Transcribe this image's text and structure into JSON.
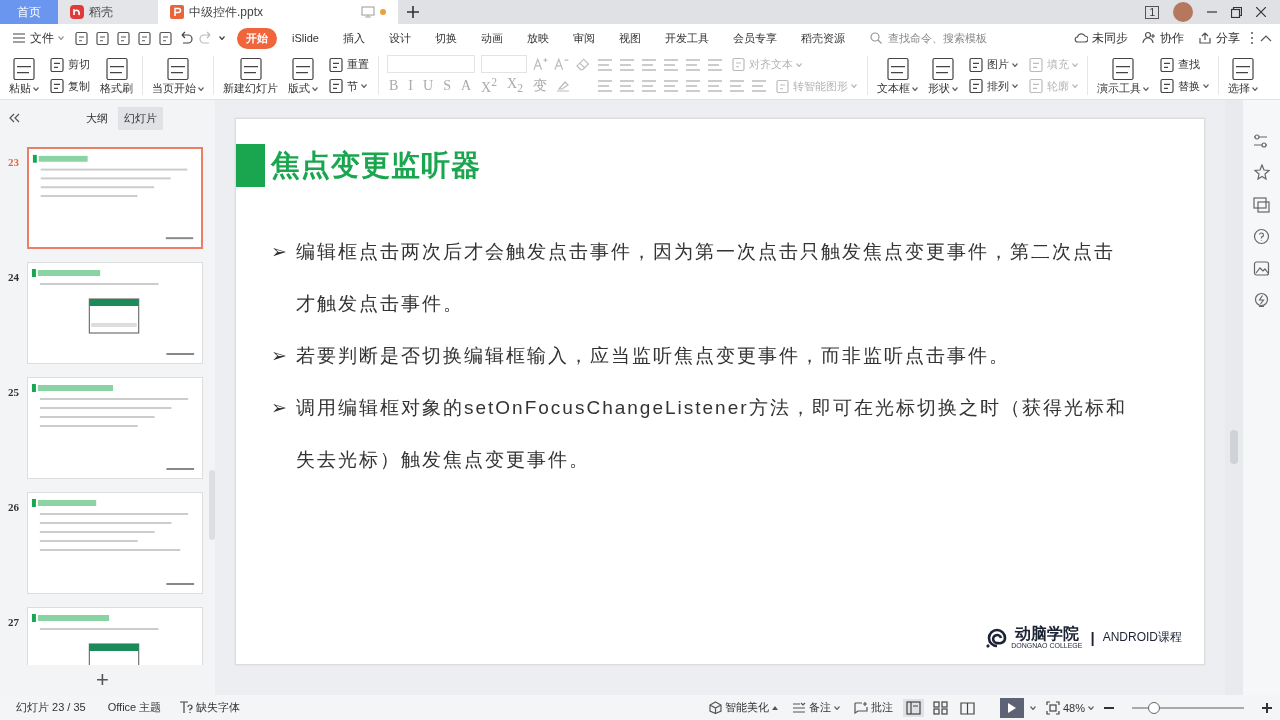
{
  "tabs": [
    {
      "label": "首页",
      "kind": "home",
      "selected": false
    },
    {
      "label": "稻壳",
      "kind": "docer",
      "selected": false
    },
    {
      "label": "中级控件.pptx",
      "kind": "doc",
      "selected": true,
      "unsaved": true
    }
  ],
  "account": {
    "badge": "1"
  },
  "menu": {
    "file": "文件",
    "tabs": [
      {
        "label": "开始",
        "selected": true
      },
      {
        "label": "iSlide",
        "selected": false
      },
      {
        "label": "插入",
        "selected": false
      },
      {
        "label": "设计",
        "selected": false
      },
      {
        "label": "切换",
        "selected": false
      },
      {
        "label": "动画",
        "selected": false
      },
      {
        "label": "放映",
        "selected": false
      },
      {
        "label": "审阅",
        "selected": false
      },
      {
        "label": "视图",
        "selected": false
      },
      {
        "label": "开发工具",
        "selected": false
      },
      {
        "label": "会员专享",
        "selected": false
      },
      {
        "label": "稻壳资源",
        "selected": false
      }
    ],
    "search": {
      "placeholder": "查找命令、搜索模板"
    },
    "actions": [
      "未同步",
      "协作",
      "分享"
    ]
  },
  "ribbon": [
    {
      "kind": "big",
      "label": "粘贴",
      "caret": true
    },
    {
      "kind": "stack",
      "items": [
        {
          "label": "剪切",
          "caret": false,
          "disabled": false
        },
        {
          "label": "复制",
          "caret": false,
          "disabled": false
        }
      ]
    },
    {
      "kind": "big",
      "label": "格式刷",
      "caret": false
    },
    {
      "kind": "sep"
    },
    {
      "kind": "big",
      "label": "当页开始",
      "caret": true
    },
    {
      "kind": "sep"
    },
    {
      "kind": "big",
      "label": "新建幻灯片",
      "caret": false
    },
    {
      "kind": "big",
      "label": "版式",
      "caret": true
    },
    {
      "kind": "stack",
      "items": [
        {
          "label": "重置",
          "caret": false,
          "disabled": false
        },
        {
          "label": "节",
          "caret": true,
          "disabled": false
        }
      ]
    },
    {
      "kind": "sep"
    },
    {
      "kind": "font",
      "marks": [
        "B",
        "I",
        "U",
        "S",
        "A",
        "X$^{2}$",
        "X$_{2}$",
        "变"
      ]
    },
    {
      "kind": "paragraph",
      "labels": [
        {
          "label": "对齐文本",
          "disabled": true
        },
        {
          "label": "转智能图形",
          "disabled": true
        }
      ]
    },
    {
      "kind": "sep"
    },
    {
      "kind": "big",
      "label": "文本框",
      "caret": true
    },
    {
      "kind": "big",
      "label": "形状",
      "caret": true
    },
    {
      "kind": "stack",
      "items": [
        {
          "label": "图片",
          "caret": true,
          "disabled": false
        },
        {
          "label": "排列",
          "caret": true,
          "disabled": false
        }
      ]
    },
    {
      "kind": "stack",
      "items": [
        {
          "label": "填充",
          "caret": true,
          "disabled": true
        },
        {
          "label": "轮廓",
          "caret": true,
          "disabled": true
        }
      ]
    },
    {
      "kind": "sep"
    },
    {
      "kind": "big",
      "label": "演示工具",
      "caret": true
    },
    {
      "kind": "stack",
      "items": [
        {
          "label": "查找",
          "caret": false,
          "disabled": false
        },
        {
          "label": "替换",
          "caret": true,
          "disabled": false
        }
      ]
    },
    {
      "kind": "sep"
    },
    {
      "kind": "big",
      "label": "选择",
      "caret": true
    }
  ],
  "panel": {
    "tabs": [
      {
        "label": "大纲",
        "selected": false
      },
      {
        "label": "幻灯片",
        "selected": true
      }
    ],
    "slides": [
      {
        "number": "23",
        "selected": true
      },
      {
        "number": "24",
        "selected": false
      },
      {
        "number": "25",
        "selected": false
      },
      {
        "number": "26",
        "selected": false
      },
      {
        "number": "27",
        "selected": false
      }
    ],
    "add": "+"
  },
  "slide": {
    "title": "焦点变更监听器",
    "bullets": [
      {
        "marker": "➢",
        "text": "编辑框点击两次后才会触发点击事件，因为第一次点击只触发焦点变更事件，第二次点击才触发点击事件。"
      },
      {
        "marker": "➢",
        "text": "若要判断是否切换编辑框输入，应当监听焦点变更事件，而非监听点击事件。"
      },
      {
        "marker": "➢",
        "text": "调用编辑框对象的setOnFocusChangeListener方法，即可在光标切换之时（获得光标和失去光标）触发焦点变更事件。"
      }
    ],
    "logo": {
      "name": "动脑学院",
      "sub": "DONGNAO COLLEGE",
      "divider": "|",
      "course": "ANDROID课程"
    }
  },
  "status_bar": {
    "slide": "幻灯片 23 / 35",
    "theme": "Office 主题",
    "font": "缺失字体",
    "beautify": "智能美化",
    "notes": "备注",
    "comments": "批注",
    "views": [
      {
        "selected": true
      },
      {
        "selected": false
      },
      {
        "selected": false
      }
    ],
    "zoom": "48%",
    "zoom_slider": {
      "level": 0.2
    }
  }
}
